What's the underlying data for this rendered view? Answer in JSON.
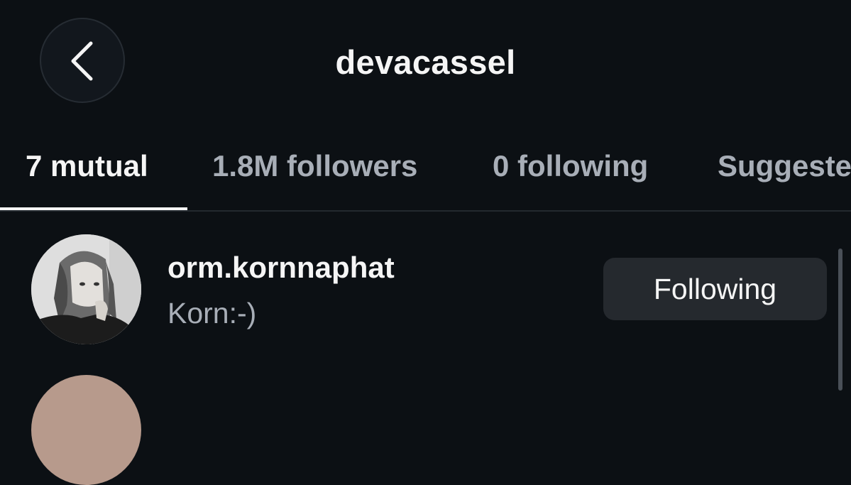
{
  "header": {
    "title": "devacassel",
    "back_icon": "chevron-left-icon"
  },
  "tabs": [
    {
      "label": "7 mutual",
      "active": true
    },
    {
      "label": "1.8M followers",
      "active": false
    },
    {
      "label": "0 following",
      "active": false
    },
    {
      "label": "Suggested",
      "active": false
    }
  ],
  "list": {
    "items": [
      {
        "username": "orm.kornnaphat",
        "full_name": "Korn:-)",
        "button_label": "Following"
      }
    ]
  },
  "colors": {
    "background": "#0c1014",
    "text_primary": "#f5f5f5",
    "text_secondary": "#a8aeb7",
    "button_bg": "#25292e"
  }
}
